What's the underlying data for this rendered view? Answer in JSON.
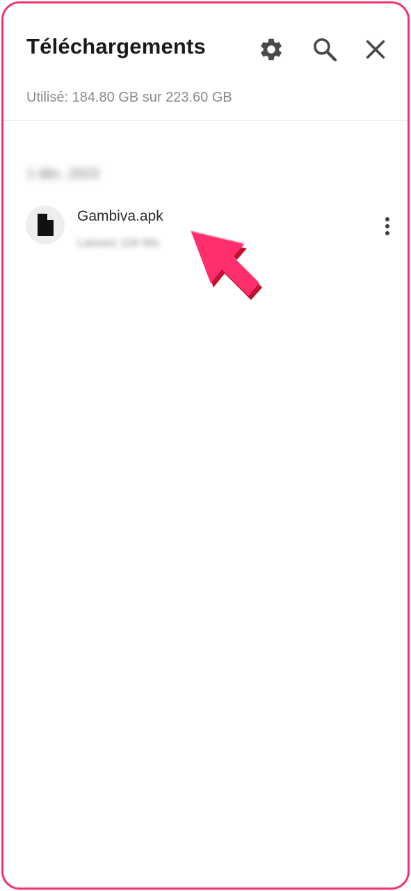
{
  "header": {
    "title": "Téléchargements",
    "usage": "Utilisé: 184.80 GB sur 223.60 GB",
    "icons": [
      "settings-gear-icon",
      "search-icon",
      "close-icon"
    ]
  },
  "downloads": {
    "section_date": "1 déc. 2023",
    "items": [
      {
        "name": "Gambiva.apk",
        "meta": "Laissez 116 Mo",
        "icon": "file-icon"
      }
    ]
  },
  "colors": {
    "frame_border": "#f2336a",
    "arrow": "#ff2e6d"
  }
}
